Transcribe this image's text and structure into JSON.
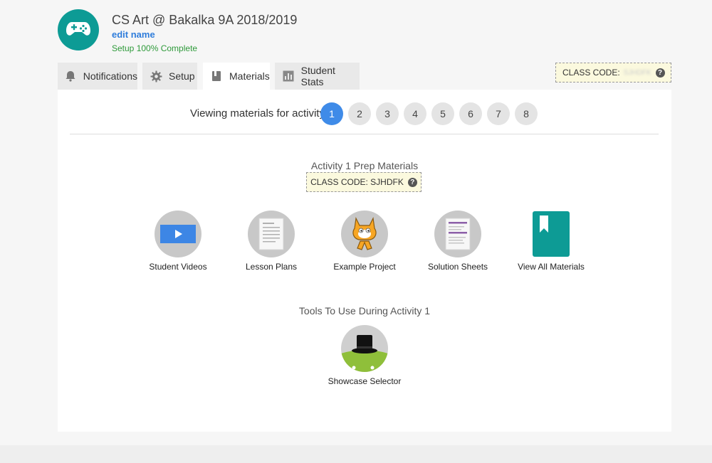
{
  "header": {
    "class_title": "CS Art @ Bakalka 9A 2018/2019",
    "edit_label": "edit name",
    "setup_status": "Setup 100% Complete"
  },
  "tabs": [
    {
      "label": "Notifications",
      "icon": "bell-icon"
    },
    {
      "label": "Setup",
      "icon": "gear-icon"
    },
    {
      "label": "Materials",
      "icon": "book-icon",
      "active": true
    },
    {
      "label": "Student Stats",
      "icon": "bar-chart-icon"
    }
  ],
  "class_code_top": {
    "label": "CLASS CODE:",
    "value": "SJHDFK"
  },
  "activity_selector": {
    "label": "Viewing materials for activity",
    "activities": [
      "1",
      "2",
      "3",
      "4",
      "5",
      "6",
      "7",
      "8"
    ],
    "selected": "1"
  },
  "prep": {
    "title": "Activity 1 Prep Materials",
    "class_code_label": "CLASS CODE: SJHDFK",
    "items": [
      {
        "label": "Student Videos",
        "icon": "video-play-icon"
      },
      {
        "label": "Lesson Plans",
        "icon": "document-icon"
      },
      {
        "label": "Example Project",
        "icon": "scratch-cat-icon"
      },
      {
        "label": "Solution Sheets",
        "icon": "solution-sheet-icon"
      },
      {
        "label": "View All Materials",
        "icon": "bookmark-book-icon"
      }
    ]
  },
  "tools": {
    "title": "Tools To Use During Activity 1",
    "items": [
      {
        "label": "Showcase Selector",
        "icon": "top-hat-icon"
      }
    ]
  },
  "colors": {
    "accent": "#0d9b95",
    "active_pill": "#3f8be8",
    "link": "#2f7ddb",
    "success": "#2e9a3a",
    "code_bg": "#fbf9de"
  }
}
